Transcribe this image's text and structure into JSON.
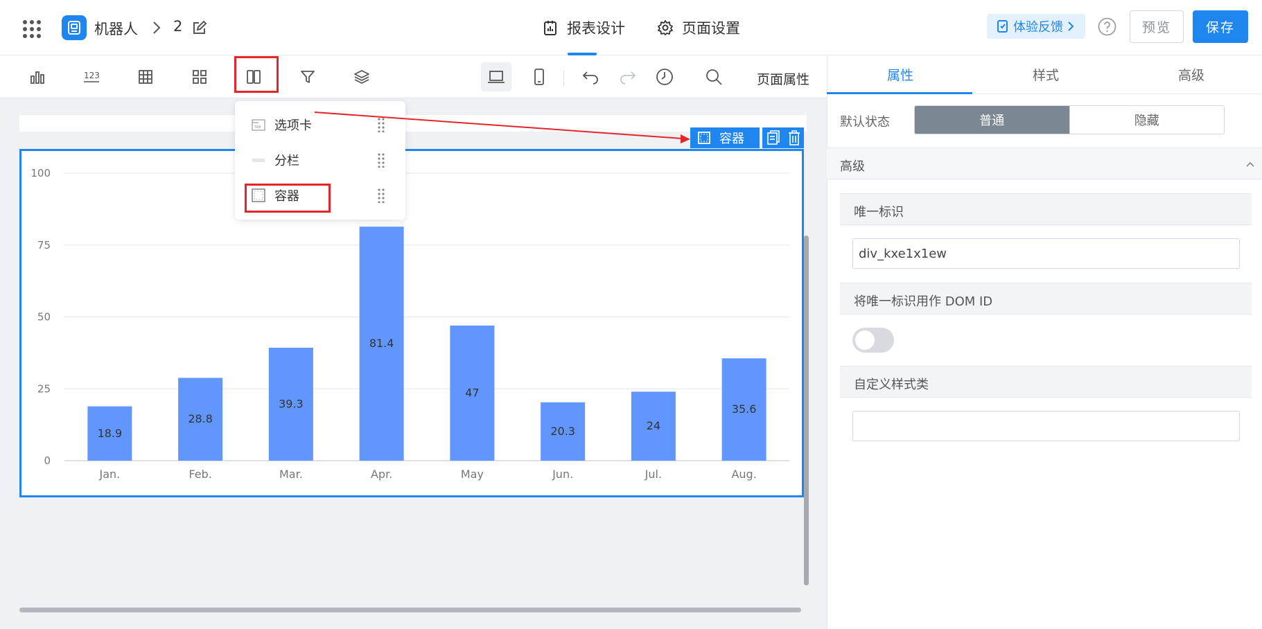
{
  "header": {
    "app_name": "机器人",
    "page_name": "2",
    "tabs": [
      {
        "label": "报表设计",
        "active": true
      },
      {
        "label": "页面设置",
        "active": false
      }
    ],
    "feedback_label": "体验反馈",
    "preview_label": "预览",
    "save_label": "保存"
  },
  "toolbar": {
    "page_props_label": "页面属性",
    "tools": [
      "bar-chart-icon",
      "number-icon",
      "table-icon",
      "grid-layout-icon",
      "columns-icon",
      "filter-icon",
      "layers-icon",
      "desktop-icon",
      "mobile-icon",
      "undo-icon",
      "redo-icon",
      "history-icon",
      "search-icon"
    ]
  },
  "dropdown": {
    "items": [
      {
        "label": "选项卡",
        "icon": "tab-icon"
      },
      {
        "label": "分栏",
        "icon": "column-split-icon"
      },
      {
        "label": "容器",
        "icon": "container-icon"
      }
    ]
  },
  "selection": {
    "tag_label": "容器"
  },
  "chart_data": {
    "type": "bar",
    "categories": [
      "Jan.",
      "Feb.",
      "Mar.",
      "Apr.",
      "May",
      "Jun.",
      "Jul.",
      "Aug."
    ],
    "values": [
      18.9,
      28.8,
      39.3,
      81.4,
      47,
      20.3,
      24,
      35.6
    ],
    "labels": [
      "18.9",
      "28.8",
      "39.3",
      "81.4",
      "47",
      "20.3",
      "24",
      "35.6"
    ],
    "yticks": [
      "0",
      "25",
      "50",
      "75",
      "100"
    ],
    "ylim": [
      0,
      100
    ],
    "grid": true,
    "color": "#6196fc"
  },
  "panel": {
    "tabs": [
      "属性",
      "样式",
      "高级"
    ],
    "default_state_label": "默认状态",
    "state_options": [
      "普通",
      "隐藏"
    ],
    "advanced_label": "高级",
    "unique_id_label": "唯一标识",
    "unique_id_value": "div_kxe1x1ew",
    "dom_id_label": "将唯一标识用作 DOM ID",
    "custom_class_label": "自定义样式类",
    "custom_class_value": ""
  }
}
